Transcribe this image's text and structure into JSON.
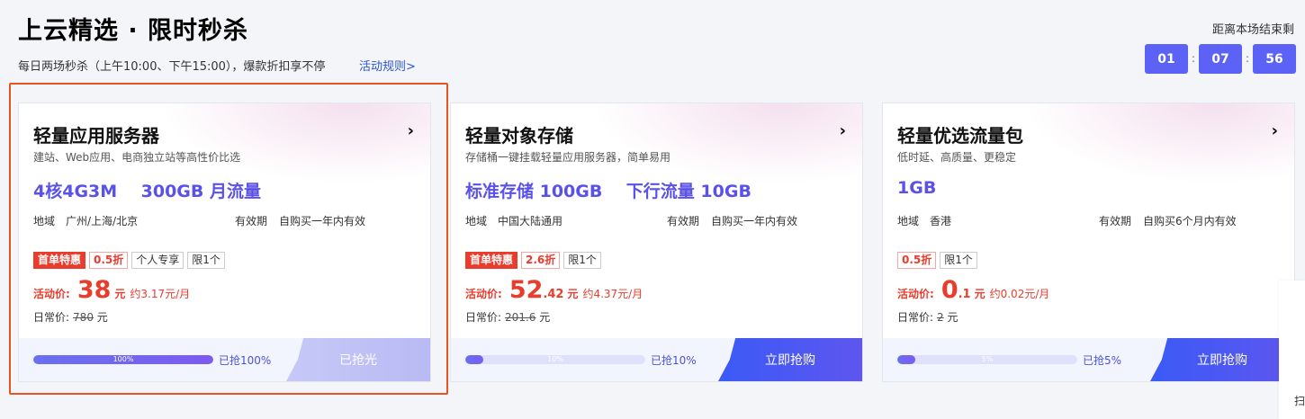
{
  "header": {
    "title": "上云精选 · 限时秒杀",
    "subtitle": "每日两场秒杀（上午10:00、下午15:00），爆款折扣享不停",
    "rules_link": "活动规则>"
  },
  "countdown": {
    "label": "距离本场结束剩",
    "hours": "01",
    "minutes": "07",
    "seconds": "56",
    "colon": ":"
  },
  "cards": [
    {
      "name": "轻量应用服务器",
      "arrow": "›",
      "desc": "建站、Web应用、电商独立站等高性价比选",
      "spec": "4核4G3M    300GB 月流量",
      "region_label": "地域",
      "region": "广州/上海/北京",
      "validity_label": "有效期",
      "validity": "自购买一年内有效",
      "tags": [
        "首单特惠",
        "0.5折",
        "个人专享",
        "限1个"
      ],
      "price_label": "活动价:",
      "price_int": "38",
      "price_dec": "",
      "price_unit": "元",
      "price_month": "约3.17元/月",
      "orig_label": "日常价:",
      "orig_price": "780",
      "orig_unit": "元",
      "progress": 100,
      "progress_text": "100%",
      "grabbed": "已抢100%",
      "button": "已抢光",
      "soldout": true
    },
    {
      "name": "轻量对象存储",
      "arrow": "›",
      "desc": "存储桶一键挂载轻量应用服务器，简单易用",
      "spec": "标准存储 100GB    下行流量 10GB",
      "region_label": "地域",
      "region": "中国大陆通用",
      "validity_label": "有效期",
      "validity": "自购买一年内有效",
      "tags": [
        "首单特惠",
        "2.6折",
        "限1个"
      ],
      "price_label": "活动价:",
      "price_int": "52",
      "price_dec": ".42",
      "price_unit": "元",
      "price_month": "约4.37元/月",
      "orig_label": "日常价:",
      "orig_price": "201.6",
      "orig_unit": "元",
      "progress": 10,
      "progress_text": "10%",
      "grabbed": "已抢10%",
      "button": "立即抢购",
      "soldout": false
    },
    {
      "name": "轻量优选流量包",
      "arrow": "›",
      "desc": "低时延、高质量、更稳定",
      "spec": "1GB",
      "region_label": "地域",
      "region": "香港",
      "validity_label": "有效期",
      "validity": "自购买6个月内有效",
      "tags": [
        "0.5折",
        "限1个"
      ],
      "price_label": "活动价:",
      "price_int": "0",
      "price_dec": ".1",
      "price_unit": "元",
      "price_month": "约0.02元/月",
      "orig_label": "日常价:",
      "orig_price": "2",
      "orig_unit": "元",
      "progress": 5,
      "progress_text": "5%",
      "grabbed": "已抢5%",
      "button": "立即抢购",
      "soldout": false
    }
  ],
  "side": {
    "char": "扫"
  },
  "colors": {
    "accent": "#5b62f5",
    "price": "#ea3c2c",
    "highlight": "#e8531e"
  }
}
